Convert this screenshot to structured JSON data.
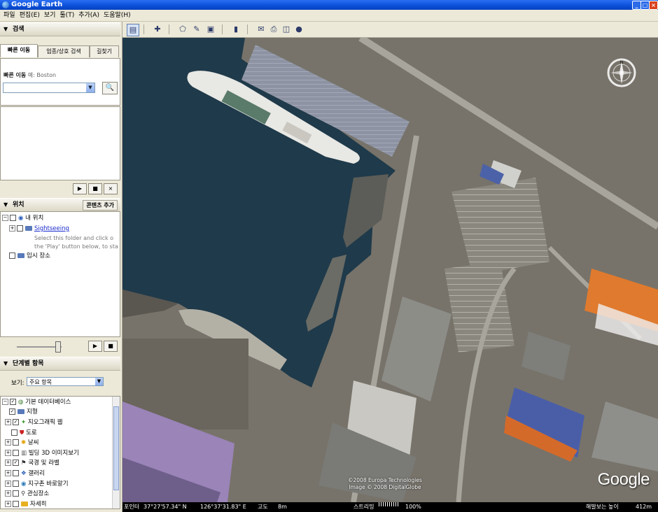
{
  "window": {
    "title": "Google Earth"
  },
  "menu": [
    "파일",
    "편집(E)",
    "보기",
    "툴(T)",
    "추가(A)",
    "도움말(H)"
  ],
  "search": {
    "section_title": "검색",
    "tabs": [
      "빠른 이동",
      "업종/상호 검색",
      "길찾기"
    ],
    "flyto_label": "빠른 이동",
    "flyto_example": "예: Boston",
    "input_value": ""
  },
  "places": {
    "section_title": "위치",
    "add_content": "콘텐츠 추가",
    "items": [
      {
        "label": "내 위치"
      },
      {
        "label": "Sightseeing"
      },
      {
        "label": "임시 장소"
      }
    ],
    "sightseeing_desc_1": "Select this folder and click o",
    "sightseeing_desc_2": "the 'Play' button below, to sta"
  },
  "layers": {
    "section_title": "단계별 항목",
    "view_label": "보기:",
    "view_value": "주요 항목",
    "items": [
      {
        "label": "기본 데이터베이스",
        "checked": true
      },
      {
        "label": "지형",
        "checked": true
      },
      {
        "label": "지오그래픽 웹",
        "checked": true
      },
      {
        "label": "도로",
        "checked": false
      },
      {
        "label": "날씨",
        "checked": false
      },
      {
        "label": "빌딩 3D 이미지보기",
        "checked": false
      },
      {
        "label": "국경 및 라벨",
        "checked": true
      },
      {
        "label": "갤러리",
        "checked": false
      },
      {
        "label": "지구촌 바로알기",
        "checked": false
      },
      {
        "label": "관심장소",
        "checked": false
      },
      {
        "label": "자세히",
        "checked": false
      }
    ]
  },
  "map": {
    "copyright_1": "©2008 Europa Technologies",
    "copyright_2": "Image © 2008 DigitalGlobe",
    "logo": "Google"
  },
  "status": {
    "lat_label": "포인터",
    "lat": "37°27'57.34\" N",
    "lon": "126°37'31.83\" E",
    "elev_label": "고도",
    "elev": "8m",
    "stream_label": "스트리밍",
    "stream_pct": "100%",
    "eye_label": "해발보는 높이",
    "eye": "412m"
  },
  "colors": {
    "titlebar": "#0a4fd8",
    "water": "#1f3a4a",
    "panel": "#ECE9D8"
  }
}
